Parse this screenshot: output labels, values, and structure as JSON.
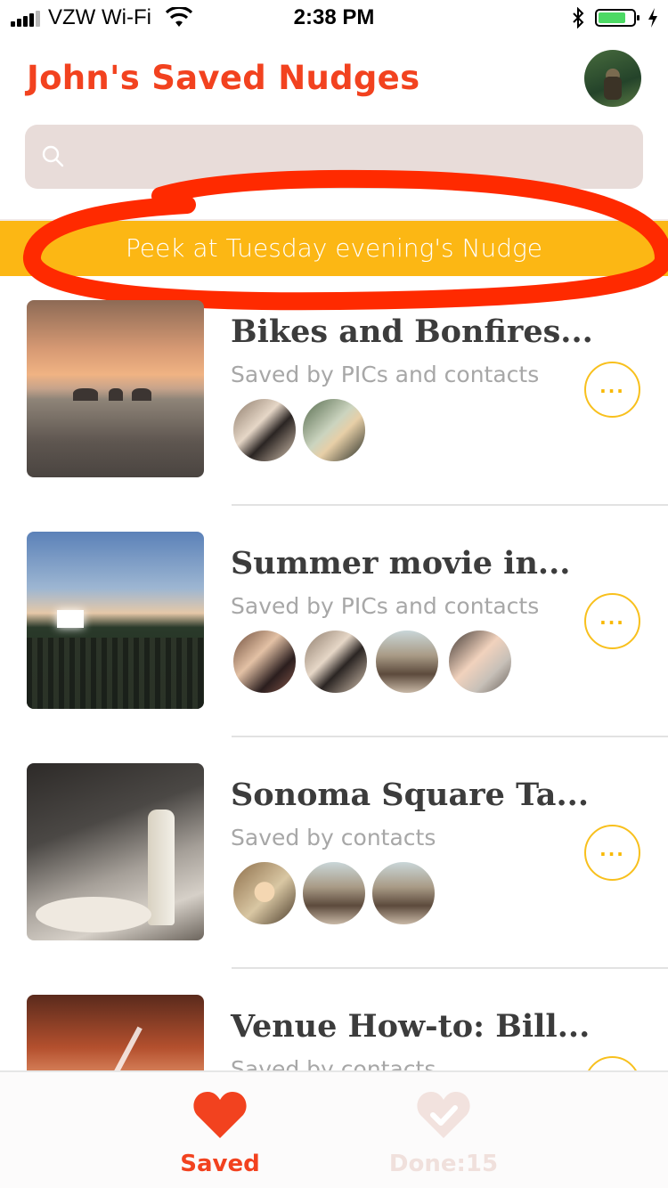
{
  "status_bar": {
    "carrier": "VZW Wi-Fi",
    "time": "2:38 PM"
  },
  "header": {
    "title": "John's Saved Nudges"
  },
  "search": {
    "placeholder": ""
  },
  "banner": {
    "label": "Peek at Tuesday evening's Nudge"
  },
  "items": [
    {
      "title": "Bikes and Bonfires...",
      "subtitle": "Saved by PICs and contacts",
      "avatar_count": 2
    },
    {
      "title": "Summer movie in...",
      "subtitle": "Saved by PICs and contacts",
      "avatar_count": 4
    },
    {
      "title": "Sonoma Square Ta...",
      "subtitle": "Saved by contacts",
      "avatar_count": 3
    },
    {
      "title": "Venue How-to: Bill...",
      "subtitle": "Saved by contacts",
      "avatar_count": 0
    }
  ],
  "more_button": {
    "label": "..."
  },
  "tabs": {
    "saved": "Saved",
    "done": "Done:15"
  },
  "colors": {
    "brand_red": "#f2421f",
    "banner_yellow": "#fcb714",
    "more_ring": "#f8c01d"
  },
  "icons": [
    "search-icon",
    "wifi-icon",
    "bluetooth-icon",
    "battery-icon",
    "heart-icon",
    "heart-check-icon"
  ]
}
